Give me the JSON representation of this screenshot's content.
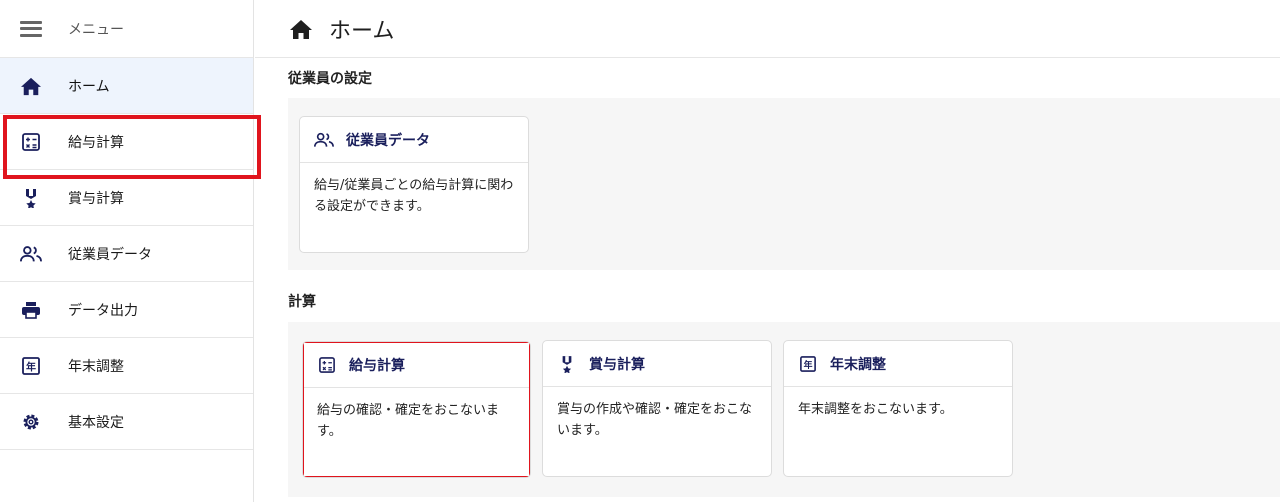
{
  "sidebar": {
    "menu_label": "メニュー",
    "items": [
      {
        "label": "ホーム"
      },
      {
        "label": "給与計算"
      },
      {
        "label": "賞与計算"
      },
      {
        "label": "従業員データ"
      },
      {
        "label": "データ出力"
      },
      {
        "label": "年末調整"
      },
      {
        "label": "基本設定"
      }
    ]
  },
  "header": {
    "title": "ホーム"
  },
  "sections": [
    {
      "title": "従業員の設定",
      "cards": [
        {
          "title": "従業員データ",
          "desc": "給与/従業員ごとの給与計算に関わる設定ができます。"
        }
      ]
    },
    {
      "title": "計算",
      "cards": [
        {
          "title": "給与計算",
          "desc": "給与の確認・確定をおこないます。"
        },
        {
          "title": "賞与計算",
          "desc": "賞与の作成や確認・確定をおこないます。"
        },
        {
          "title": "年末調整",
          "desc": "年末調整をおこないます。"
        }
      ]
    }
  ],
  "colors": {
    "navy": "#1a1f5c",
    "highlight": "#e0141d",
    "active_bg": "#eef4fd"
  }
}
